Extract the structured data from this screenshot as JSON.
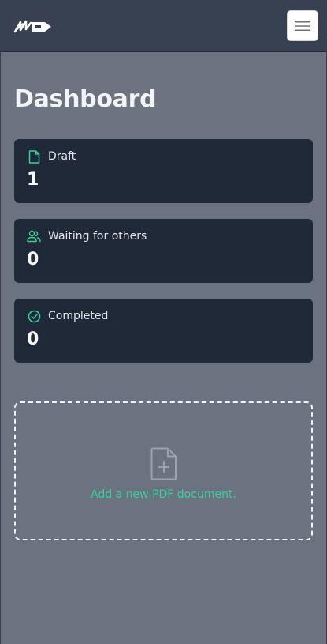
{
  "header": {
    "logo_icon": "logo-icon",
    "menu_icon": "hamburger-menu-icon"
  },
  "page": {
    "title": "Dashboard"
  },
  "stats": [
    {
      "label": "Draft",
      "value": "1",
      "icon": "file-icon"
    },
    {
      "label": "Waiting for others",
      "value": "0",
      "icon": "users-icon"
    },
    {
      "label": "Completed",
      "value": "0",
      "icon": "check-circle-icon"
    }
  ],
  "upload": {
    "text": "Add a new PDF document.",
    "icon": "file-plus-icon"
  },
  "colors": {
    "accent": "#34d399",
    "card_bg": "#1f2937",
    "page_bg": "#6b7280",
    "header_bg": "#374151"
  }
}
